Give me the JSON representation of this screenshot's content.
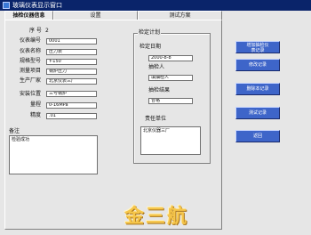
{
  "window": {
    "title": "玻璃仪表显示窗口"
  },
  "tabs": [
    {
      "label": "抽检仪器信息"
    },
    {
      "label": "设置"
    },
    {
      "label": "测试方案"
    }
  ],
  "info": {
    "seq_label": "序 号",
    "seq_value": "2",
    "fields": [
      {
        "label": "仪表编号",
        "value": "0001"
      },
      {
        "label": "仪表名称",
        "value": "压力表"
      },
      {
        "label": "规格型号",
        "value": "Y-150"
      },
      {
        "label": "测量项目",
        "value": "锅炉压力"
      },
      {
        "label": "生产厂家",
        "value": "北京仪表三厂"
      },
      {
        "label": "安装位置",
        "value": "三号锅炉"
      },
      {
        "label": "量程",
        "value": "0-16MPa"
      },
      {
        "label": "精度",
        "value": ".01"
      }
    ],
    "remark_label": "备注",
    "remark_value": "检验成功"
  },
  "plan": {
    "group_title": "检定计划",
    "date_label": "检定日期",
    "date_value": "2000-8-8",
    "inspector_label": "抽检人",
    "inspector_value": "填抽检人",
    "result_label": "抽检结果",
    "result_value": "合格",
    "unit_label": "责任单位",
    "unit_value": "北京仪器三厂"
  },
  "side_buttons": [
    {
      "label_line1": "增加抽检仪",
      "label_line2": "表记录"
    },
    {
      "label": "修改记录"
    },
    {
      "label": "删除本记录"
    },
    {
      "label": "测试记录"
    },
    {
      "label": "返回"
    }
  ],
  "watermark": "金三航",
  "colors": {
    "titlebar": "#0a246a",
    "button": "#3e65c9",
    "watermark": "#f6c64a"
  }
}
